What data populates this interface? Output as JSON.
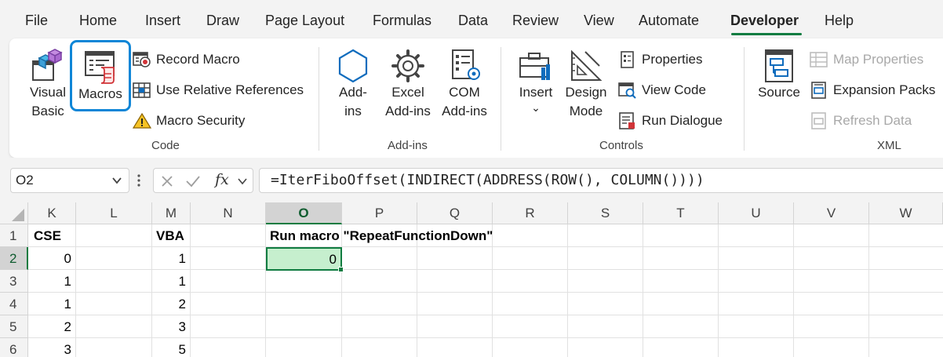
{
  "menu": {
    "tabs": [
      "File",
      "Home",
      "Insert",
      "Draw",
      "Page Layout",
      "Formulas",
      "Data",
      "Review",
      "View",
      "Automate",
      "Developer",
      "Help"
    ],
    "active": "Developer"
  },
  "ribbon": {
    "code": {
      "label": "Code",
      "visual_basic": [
        "Visual",
        "Basic"
      ],
      "macros": "Macros",
      "record_macro": "Record Macro",
      "use_relative_references": "Use Relative References",
      "macro_security": "Macro Security"
    },
    "addins": {
      "label": "Add-ins",
      "addins": [
        "Add-",
        "ins"
      ],
      "excel_addins": [
        "Excel",
        "Add-ins"
      ],
      "com_addins": [
        "COM",
        "Add-ins"
      ]
    },
    "controls": {
      "label": "Controls",
      "insert": "Insert",
      "design_mode": [
        "Design",
        "Mode"
      ],
      "properties": "Properties",
      "view_code": "View Code",
      "run_dialogue": "Run Dialogue"
    },
    "xml": {
      "label": "XML",
      "source": "Source",
      "map_properties": "Map Properties",
      "expansion_packs": "Expansion Packs",
      "refresh_data": "Refresh Data"
    }
  },
  "formula_bar": {
    "name_box": "O2",
    "formula": "=IterFiboOffset(INDIRECT(ADDRESS(ROW(), COLUMN())))"
  },
  "sheet": {
    "columns": [
      "K",
      "L",
      "M",
      "N",
      "O",
      "P",
      "Q",
      "R",
      "S",
      "T",
      "U",
      "V",
      "W"
    ],
    "selected_column": "O",
    "rows": [
      "1",
      "2",
      "3",
      "4",
      "5",
      "6"
    ],
    "selected_row": "2",
    "headers": {
      "k1": "CSE",
      "m1": "VBA",
      "o1": "Run macro \"RepeatFunctionDown\""
    },
    "col_k": [
      "0",
      "1",
      "1",
      "2",
      "3"
    ],
    "col_m": [
      "1",
      "1",
      "2",
      "3",
      "5"
    ],
    "o2": "0"
  },
  "colors": {
    "accent": "#107c41",
    "selection_fill": "#c6efce",
    "highlight_ring": "#0f86d7"
  }
}
